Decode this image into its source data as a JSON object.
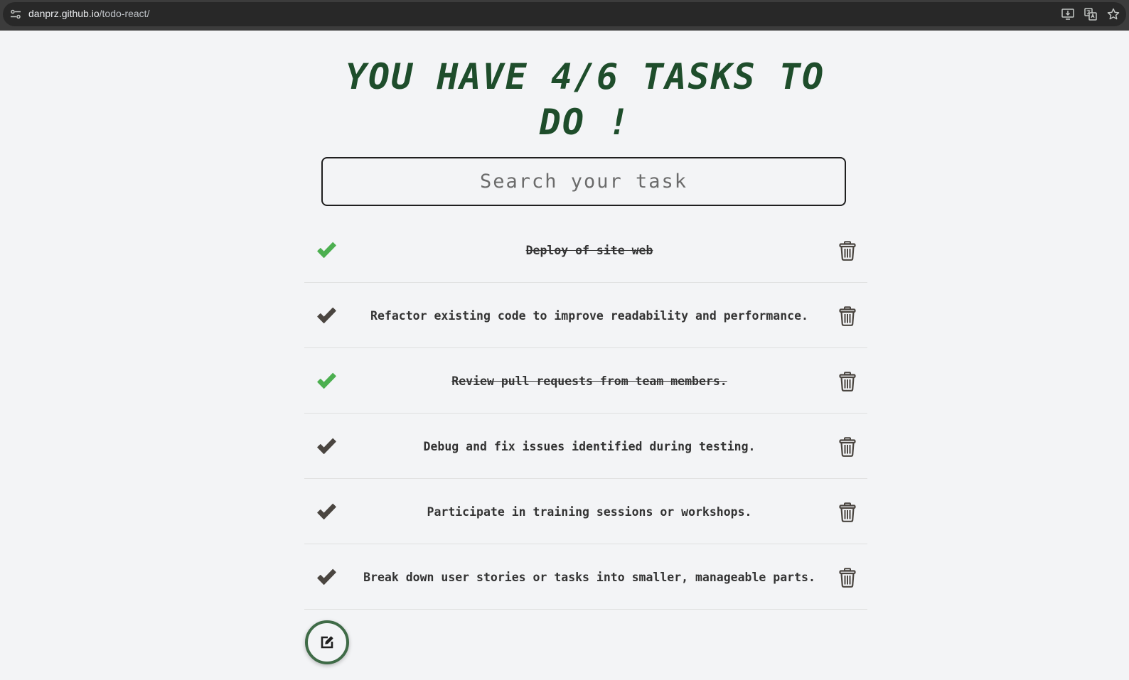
{
  "browser": {
    "url_host": "danprz.github.io",
    "url_path": "/todo-react/"
  },
  "title": {
    "line1": "YOU HAVE 4/6 TASKS TO",
    "line2": "DO !"
  },
  "search": {
    "placeholder": "Search your task",
    "value": ""
  },
  "todos": [
    {
      "text": "Deploy of site web",
      "completed": true
    },
    {
      "text": "Refactor existing code to improve readability and performance.",
      "completed": false
    },
    {
      "text": "Review pull requests from team members.",
      "completed": true
    },
    {
      "text": "Debug and fix issues identified during testing.",
      "completed": false
    },
    {
      "text": "Participate in training sessions or workshops.",
      "completed": false
    },
    {
      "text": "Break down user stories or tasks into smaller, manageable parts.",
      "completed": false
    }
  ],
  "icons": {
    "check": "check-icon",
    "delete": "trash-icon",
    "create": "edit-icon"
  },
  "colors": {
    "completed_check": "#4caf50",
    "pending_check": "#4a4540",
    "title": "#1e4d2b",
    "accent": "#3f6b47"
  }
}
